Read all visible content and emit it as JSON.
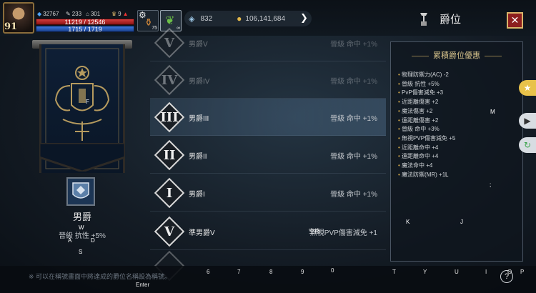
{
  "player": {
    "level": "91",
    "gems": "32767",
    "stat_a": "233",
    "stat_b": "301",
    "stat_c": "9",
    "hp": "11219 / 12546",
    "mp": "1715 / 1719",
    "potion_count": "75",
    "slot2_count": "∞"
  },
  "currency": {
    "diamonds": "832",
    "gold": "106,141,684"
  },
  "window": {
    "title": "爵位",
    "close": "✕"
  },
  "current_rank": {
    "name": "男爵",
    "bonus": "晉級 抗性 +5%"
  },
  "ranks": [
    {
      "numeral": "V",
      "name": "男爵V",
      "stat": "晉級 命中 +1%",
      "state": "dim"
    },
    {
      "numeral": "IV",
      "name": "男爵IV",
      "stat": "晉級 命中 +1%",
      "state": "dim"
    },
    {
      "numeral": "III",
      "name": "男爵III",
      "stat": "晉級 命中 +1%",
      "state": "highlight"
    },
    {
      "numeral": "II",
      "name": "男爵II",
      "stat": "晉級 命中 +1%",
      "state": "normal"
    },
    {
      "numeral": "I",
      "name": "男爵I",
      "stat": "晉級 命中 +1%",
      "state": "normal"
    },
    {
      "numeral": "V",
      "name": "準男爵V",
      "stat": "無視PVP傷害減免 +1",
      "state": "normal"
    }
  ],
  "benefits": {
    "title": "累積爵位優惠",
    "items": [
      "物理防禦力(AC) -2",
      "晉級 抗性 +5%",
      "PvP傷害減免 +3",
      "近距離傷害 +2",
      "魔法傷害 +2",
      "遠距離傷害 +2",
      "晉級 命中 +3%",
      "無視PVP傷害減免 +5",
      "近距離命中 +4",
      "遠距離命中 +4",
      "魔法命中 +4",
      "魔法防禦(MR) +1"
    ]
  },
  "footer": {
    "notice": "※ 可以在稱號畫面中將達成的爵位名稱設為稱號。"
  },
  "keys": {
    "row": [
      "6",
      "7",
      "8",
      "9",
      "0",
      "T",
      "Y",
      "U",
      "I",
      "O",
      "P"
    ],
    "enter": "Enter",
    "left": [
      "F",
      "W",
      "A",
      "D",
      "S"
    ],
    "right": [
      "M",
      "L",
      ";",
      "K",
      "J"
    ],
    "space": "空格"
  },
  "colors": {
    "accent_gold": "#d9b46a",
    "close_red": "#8c1e1e",
    "hp": "#d43c3c",
    "mp": "#3c7ae0"
  }
}
